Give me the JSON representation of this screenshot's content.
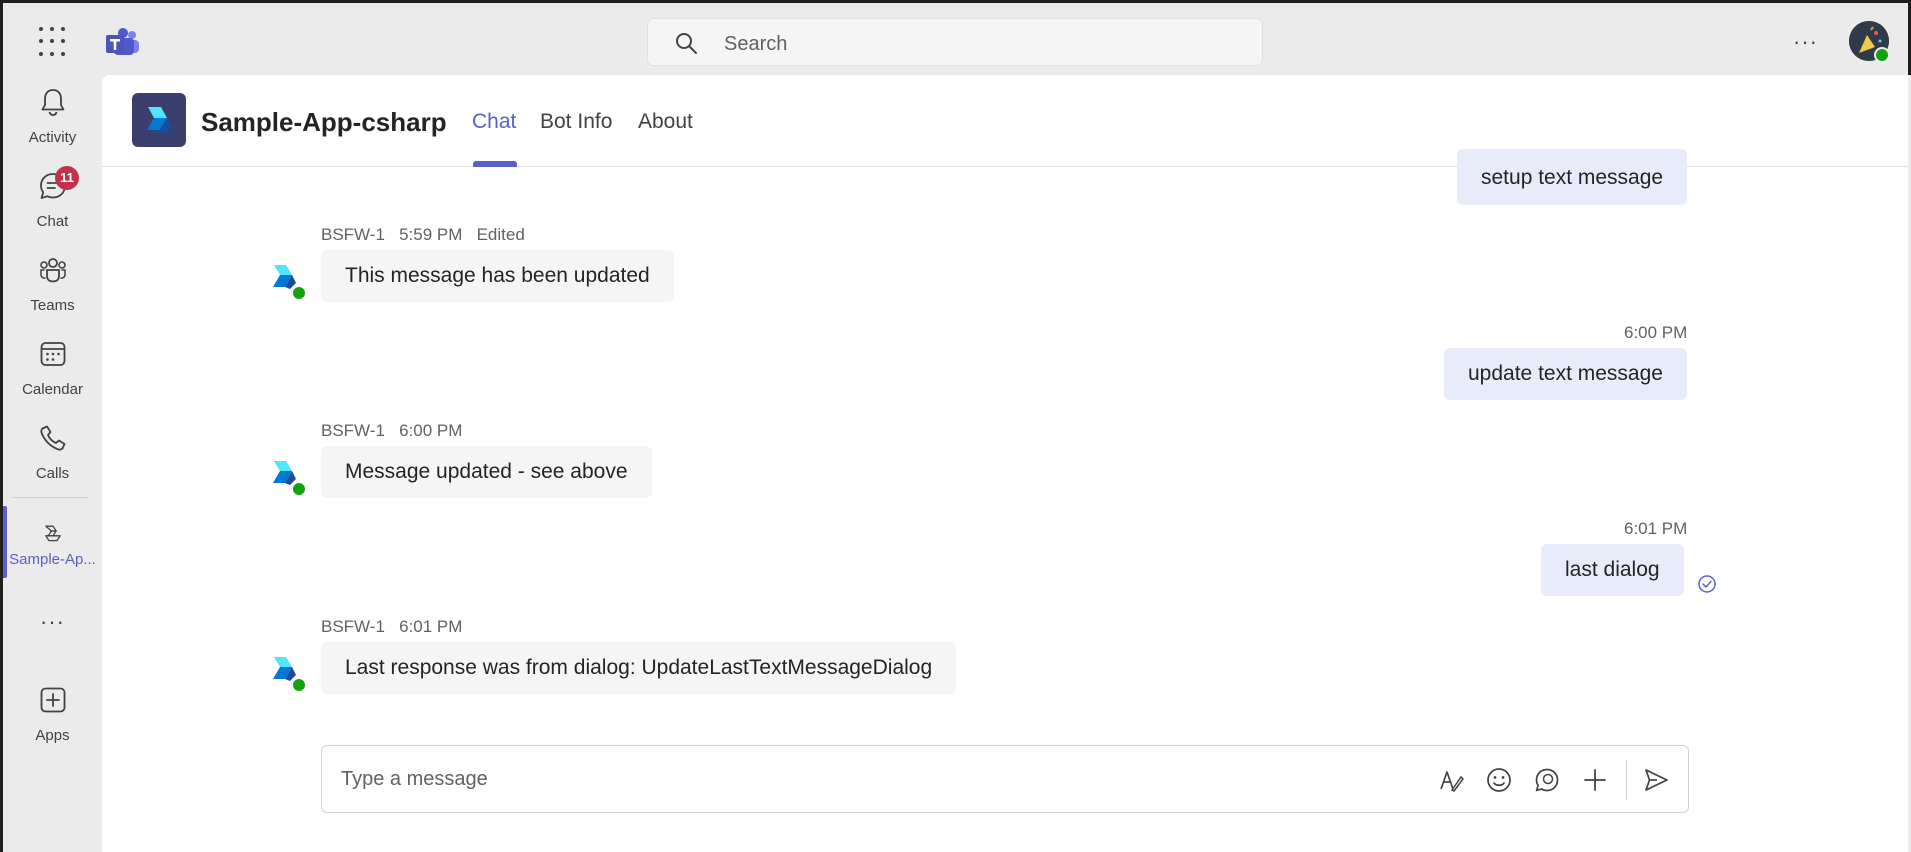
{
  "topbar": {
    "search_placeholder": "Search",
    "more_label": "···"
  },
  "rail": {
    "items": [
      {
        "label": "Activity",
        "icon": "bell-icon"
      },
      {
        "label": "Chat",
        "icon": "chat-icon",
        "badge": "11"
      },
      {
        "label": "Teams",
        "icon": "teams-icon"
      },
      {
        "label": "Calendar",
        "icon": "calendar-icon"
      },
      {
        "label": "Calls",
        "icon": "phone-icon"
      },
      {
        "label": "Sample-Ap...",
        "icon": "sample-app-icon"
      },
      {
        "label": "",
        "icon": "more-apps-icon"
      },
      {
        "label": "Apps",
        "icon": "add-apps-icon"
      }
    ],
    "more_label": "···"
  },
  "header": {
    "app_title": "Sample-App-csharp",
    "tabs": [
      {
        "label": "Chat"
      },
      {
        "label": "Bot Info"
      },
      {
        "label": "About"
      }
    ]
  },
  "messages": [
    {
      "direction": "out",
      "time": "",
      "text": "setup text message"
    },
    {
      "direction": "in",
      "sender": "BSFW-1",
      "time": "5:59 PM",
      "edited": "Edited",
      "text": "This message has been updated"
    },
    {
      "direction": "out",
      "time": "6:00 PM",
      "text": "update text message"
    },
    {
      "direction": "in",
      "sender": "BSFW-1",
      "time": "6:00 PM",
      "text": "Message updated - see above"
    },
    {
      "direction": "out",
      "time": "6:01 PM",
      "text": "last dialog"
    },
    {
      "direction": "in",
      "sender": "BSFW-1",
      "time": "6:01 PM",
      "text": "Last response was from dialog: UpdateLastTextMessageDialog"
    }
  ],
  "composer": {
    "placeholder": "Type a message"
  },
  "colors": {
    "accent": "#5b5fc7",
    "badge": "#c4314b",
    "presence": "#13a10e",
    "outgoing_bubble": "#e8ebfa",
    "incoming_bubble": "#f5f5f5"
  }
}
